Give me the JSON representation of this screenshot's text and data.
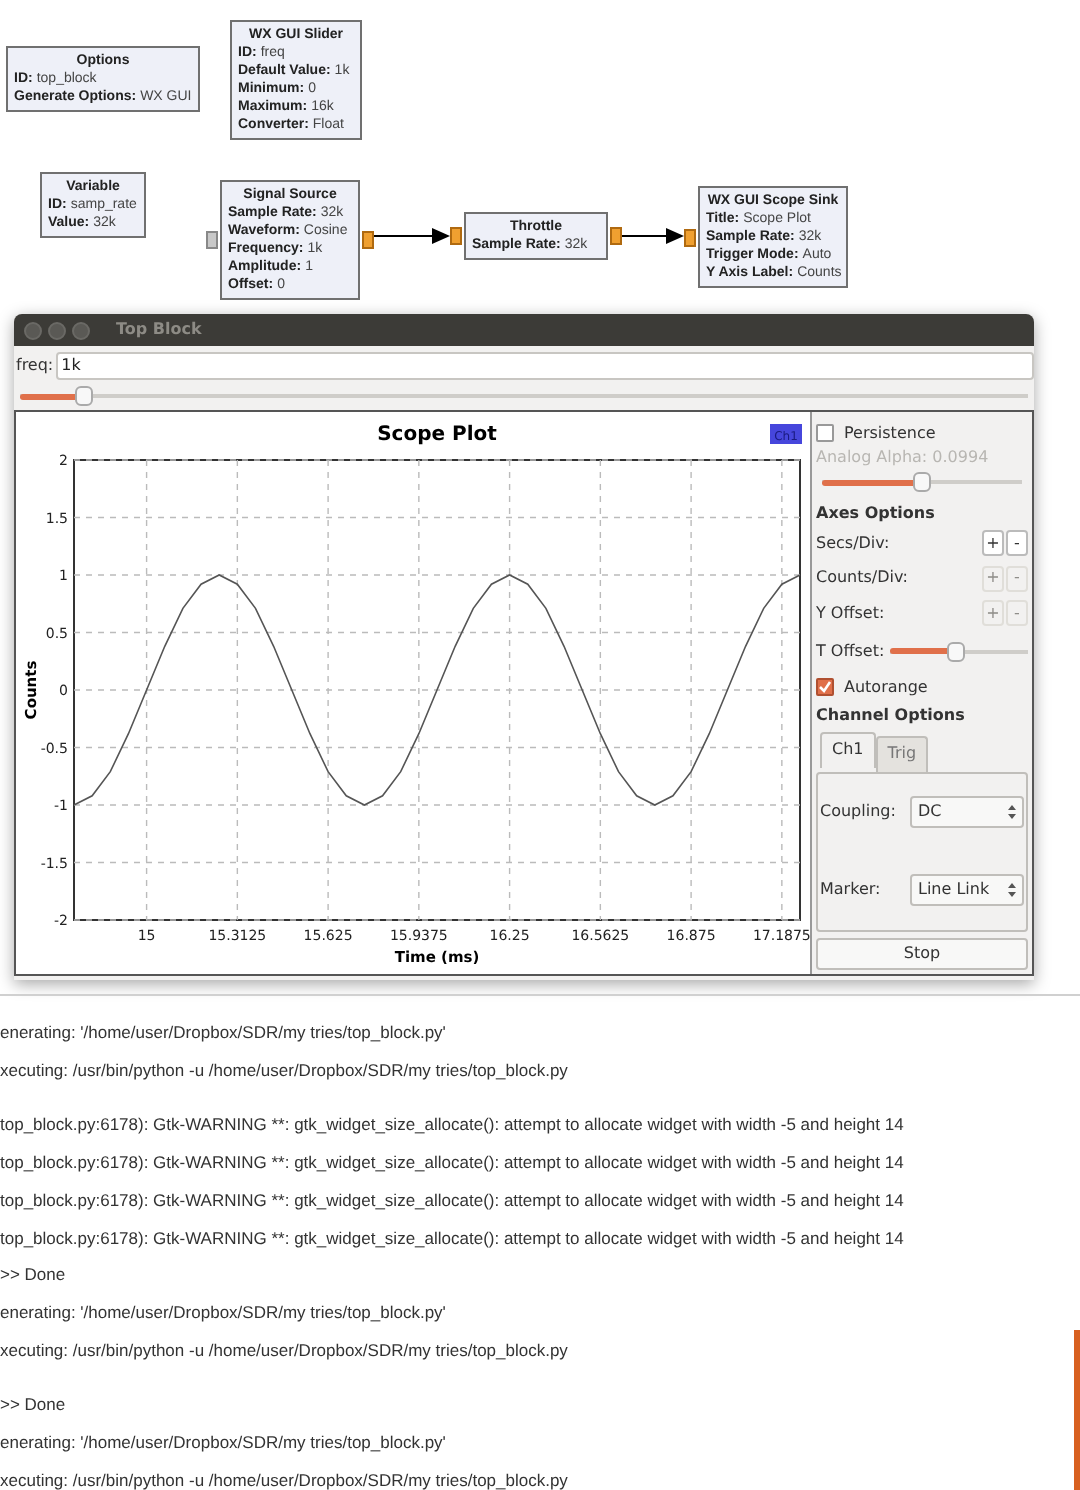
{
  "flowgraph": {
    "blocks": [
      {
        "title": "Options",
        "params": [
          {
            "name": "ID:",
            "value": "top_block"
          },
          {
            "name": "Generate Options:",
            "value": "WX GUI"
          }
        ]
      },
      {
        "title": "WX GUI Slider",
        "params": [
          {
            "name": "ID:",
            "value": "freq"
          },
          {
            "name": "Default Value:",
            "value": "1k"
          },
          {
            "name": "Minimum:",
            "value": "0"
          },
          {
            "name": "Maximum:",
            "value": "16k"
          },
          {
            "name": "Converter:",
            "value": "Float"
          }
        ]
      },
      {
        "title": "Variable",
        "params": [
          {
            "name": "ID:",
            "value": "samp_rate"
          },
          {
            "name": "Value:",
            "value": "32k"
          }
        ]
      },
      {
        "title": "Signal Source",
        "in_port": {
          "connected": false
        },
        "out_port": {
          "connected": true
        },
        "params": [
          {
            "name": "Sample Rate:",
            "value": "32k"
          },
          {
            "name": "Waveform:",
            "value": "Cosine"
          },
          {
            "name": "Frequency:",
            "value": "1k"
          },
          {
            "name": "Amplitude:",
            "value": "1"
          },
          {
            "name": "Offset:",
            "value": "0"
          }
        ]
      },
      {
        "title": "Throttle",
        "in_port": {
          "connected": true
        },
        "out_port": {
          "connected": true
        },
        "params": [
          {
            "name": "Sample Rate:",
            "value": "32k"
          }
        ]
      },
      {
        "title": "WX GUI Scope Sink",
        "in_port": {
          "connected": true
        },
        "params": [
          {
            "name": "Title:",
            "value": "Scope Plot"
          },
          {
            "name": "Sample Rate:",
            "value": "32k"
          },
          {
            "name": "Trigger Mode:",
            "value": "Auto"
          },
          {
            "name": "Y Axis Label:",
            "value": "Counts"
          }
        ]
      }
    ]
  },
  "window": {
    "title": "Top Block"
  },
  "freq": {
    "label": "freq:",
    "value": "1k",
    "level": 0.0625
  },
  "scope": {
    "legend": {
      "color": "#4646dc"
    },
    "chart_data": {
      "type": "line",
      "title": "Scope Plot",
      "xlabel": "Time (ms)",
      "ylabel": "Counts",
      "x": [
        14.75,
        14.8125,
        14.875,
        14.9375,
        15,
        15.0625,
        15.125,
        15.1875,
        15.25,
        15.3125,
        15.375,
        15.4375,
        15.5,
        15.5625,
        15.625,
        15.6875,
        15.75,
        15.8125,
        15.875,
        15.9375,
        16,
        16.0625,
        16.125,
        16.1875,
        16.25,
        16.3125,
        16.375,
        16.4375,
        16.5,
        16.5625,
        16.625,
        16.6875,
        16.75,
        16.8125,
        16.875,
        16.9375,
        17,
        17.0625,
        17.125,
        17.1875,
        17.25
      ],
      "series": [
        {
          "name": "Ch1",
          "color": "#555555",
          "values": [
            -1,
            -0.92,
            -0.71,
            -0.38,
            0,
            0.38,
            0.71,
            0.92,
            1,
            0.92,
            0.71,
            0.38,
            0,
            -0.38,
            -0.71,
            -0.92,
            -1,
            -0.92,
            -0.71,
            -0.38,
            0,
            0.38,
            0.71,
            0.92,
            1,
            0.92,
            0.71,
            0.38,
            0,
            -0.38,
            -0.71,
            -0.92,
            -1,
            -0.92,
            -0.71,
            -0.38,
            0,
            0.38,
            0.71,
            0.92,
            1
          ]
        }
      ],
      "xlim": [
        14.75,
        17.25
      ],
      "ylim": [
        -2,
        2
      ],
      "grid": true,
      "xticks": [
        15,
        15.3125,
        15.625,
        15.9375,
        16.25,
        16.5625,
        16.875,
        17.1875
      ],
      "yticks": [
        -2,
        -1.5,
        -1,
        -0.5,
        0,
        0.5,
        1,
        1.5,
        2
      ]
    }
  },
  "panel": {
    "persistence": {
      "label": "Persistence",
      "checked": false
    },
    "analog_alpha": {
      "label": "Analog Alpha: 0.0994",
      "disabled": true,
      "level": 0.5
    },
    "axes_heading": "Axes Options",
    "axes_rows": [
      {
        "kind": "buttons",
        "label": "Secs/Div:",
        "plus": "+",
        "minus": "-",
        "disabled": false
      },
      {
        "kind": "buttons",
        "label": "Counts/Div:",
        "plus": "+",
        "minus": "-",
        "disabled": true
      },
      {
        "kind": "buttons",
        "label": "Y Offset:",
        "plus": "+",
        "minus": "-",
        "disabled": true
      },
      {
        "kind": "slider",
        "label": "T Offset:",
        "level": 0.48
      }
    ],
    "autorange": {
      "label": "Autorange",
      "checked": true
    },
    "channel_heading": "Channel Options",
    "tabs": [
      {
        "label": "Ch1",
        "selected": true
      },
      {
        "label": "Trig",
        "selected": false
      }
    ],
    "fields": [
      {
        "label": "Coupling:",
        "value": "DC"
      },
      {
        "label": "Marker:",
        "value": "Line Link"
      }
    ],
    "stop_button": "Stop"
  },
  "console": {
    "blocks": [
      [
        "enerating: '/home/user/Dropbox/SDR/my tries/top_block.py'",
        "xecuting: /usr/bin/python -u /home/user/Dropbox/SDR/my tries/top_block.py"
      ],
      [
        "top_block.py:6178): Gtk-WARNING **: gtk_widget_size_allocate(): attempt to allocate widget with width -5 and height 14",
        "top_block.py:6178): Gtk-WARNING **: gtk_widget_size_allocate(): attempt to allocate widget with width -5 and height 14",
        "top_block.py:6178): Gtk-WARNING **: gtk_widget_size_allocate(): attempt to allocate widget with width -5 and height 14",
        "top_block.py:6178): Gtk-WARNING **: gtk_widget_size_allocate(): attempt to allocate widget with width -5 and height 14",
        ">> Done",
        "enerating: '/home/user/Dropbox/SDR/my tries/top_block.py'",
        "xecuting: /usr/bin/python -u /home/user/Dropbox/SDR/my tries/top_block.py"
      ],
      [
        ">> Done",
        "enerating: '/home/user/Dropbox/SDR/my tries/top_block.py'",
        "xecuting: /usr/bin/python -u /home/user/Dropbox/SDR/my tries/top_block.py"
      ]
    ]
  }
}
